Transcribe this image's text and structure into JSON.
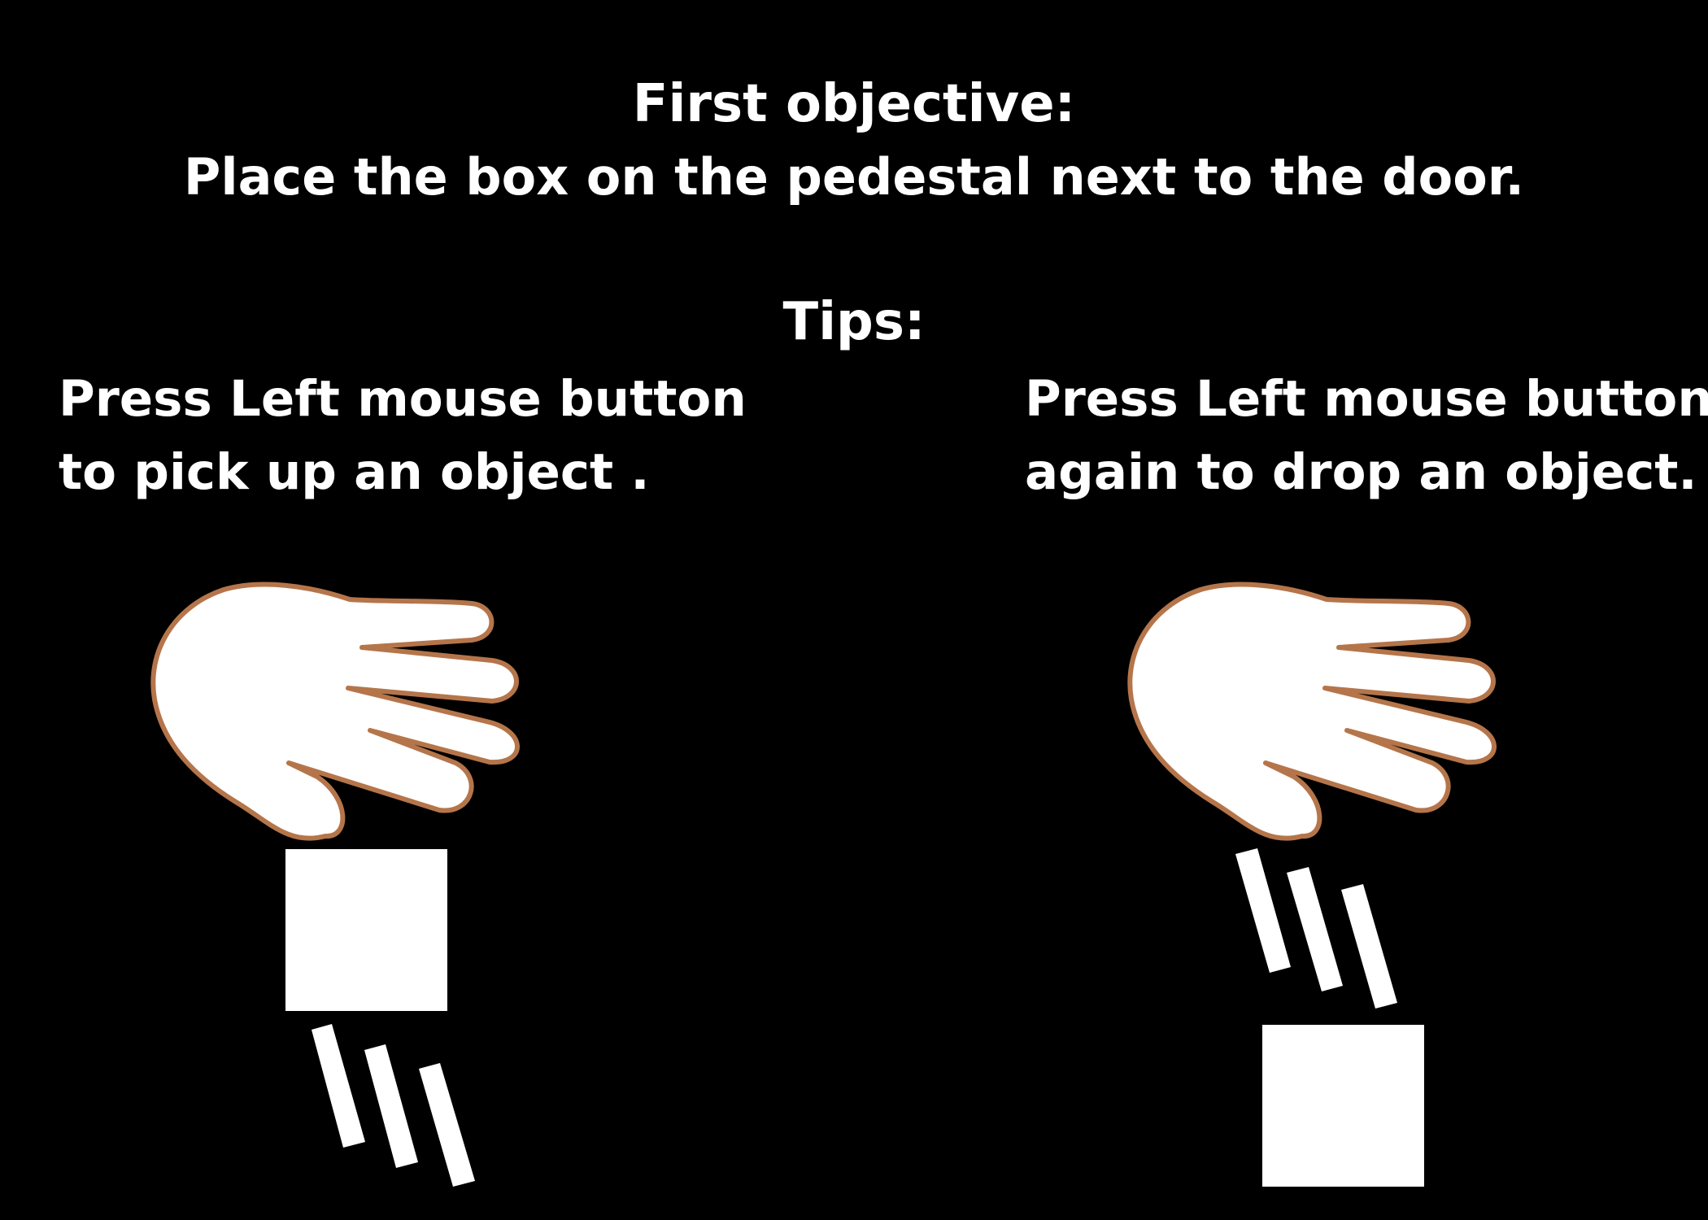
{
  "objective": {
    "heading": "First objective:",
    "text": "Place the box on the pedestal next to the door."
  },
  "tips": {
    "heading": "Tips:",
    "pickup": {
      "line1": "Press Left mouse button",
      "line2": "to pick up an object ."
    },
    "drop": {
      "line1": "Press Left mouse button",
      "line2": "again to drop an object."
    }
  },
  "illustrations": {
    "pickup": [
      "hand-icon",
      "box-icon",
      "motion-lines-icon"
    ],
    "drop": [
      "hand-icon",
      "motion-lines-icon",
      "box-icon"
    ]
  },
  "colors": {
    "background": "#000000",
    "text": "#ffffff",
    "hand_fill": "#ffffff",
    "hand_outline": "#b5754a",
    "box": "#ffffff"
  }
}
